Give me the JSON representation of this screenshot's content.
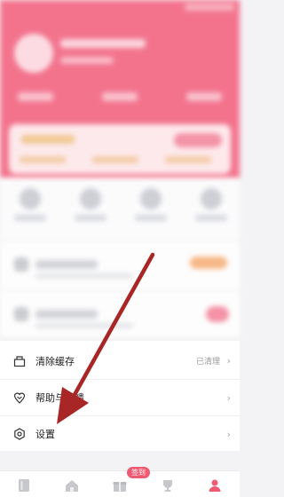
{
  "menu": {
    "items": [
      {
        "label": "清除缓存",
        "value": "已清理",
        "icon": "box-icon"
      },
      {
        "label": "帮助与反馈",
        "value": "",
        "icon": "heart-pin-icon"
      },
      {
        "label": "设置",
        "value": "",
        "icon": "gear-icon"
      }
    ]
  },
  "bottom_nav": {
    "items": [
      {
        "icon": "book-icon"
      },
      {
        "icon": "home-icon"
      },
      {
        "icon": "gift-icon"
      },
      {
        "icon": "trophy-icon"
      },
      {
        "icon": "profile-icon"
      }
    ],
    "badge": "签到"
  },
  "annotation": {
    "type": "arrow",
    "color": "#b12a2a"
  },
  "colors": {
    "brand": "#f26884",
    "arrow": "#a82626",
    "nav_active": "#ef5a72"
  }
}
